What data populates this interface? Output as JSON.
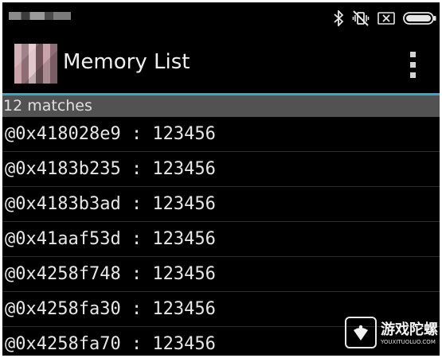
{
  "status_bar": {
    "icons": [
      "bluetooth-icon",
      "vibrate-off-icon",
      "sim-absent-icon",
      "battery-icon"
    ]
  },
  "app_bar": {
    "title": "Memory List",
    "overflow_icon": "more-vertical-icon"
  },
  "colors": {
    "accent": "#35a8d0",
    "header_bg": "#525252",
    "background": "#000000"
  },
  "list": {
    "header": "12 matches",
    "items": [
      {
        "text": "@0x418028e9 : 123456"
      },
      {
        "text": "@0x4183b235 : 123456"
      },
      {
        "text": "@0x4183b3ad : 123456"
      },
      {
        "text": "@0x41aaf53d : 123456"
      },
      {
        "text": "@0x4258f748 : 123456"
      },
      {
        "text": "@0x4258fa30 : 123456"
      },
      {
        "text": "@0x4258fa70 : 123456"
      }
    ]
  },
  "watermark": {
    "name": "游戏陀螺",
    "url": "YOUXITUOLUO.COM"
  }
}
